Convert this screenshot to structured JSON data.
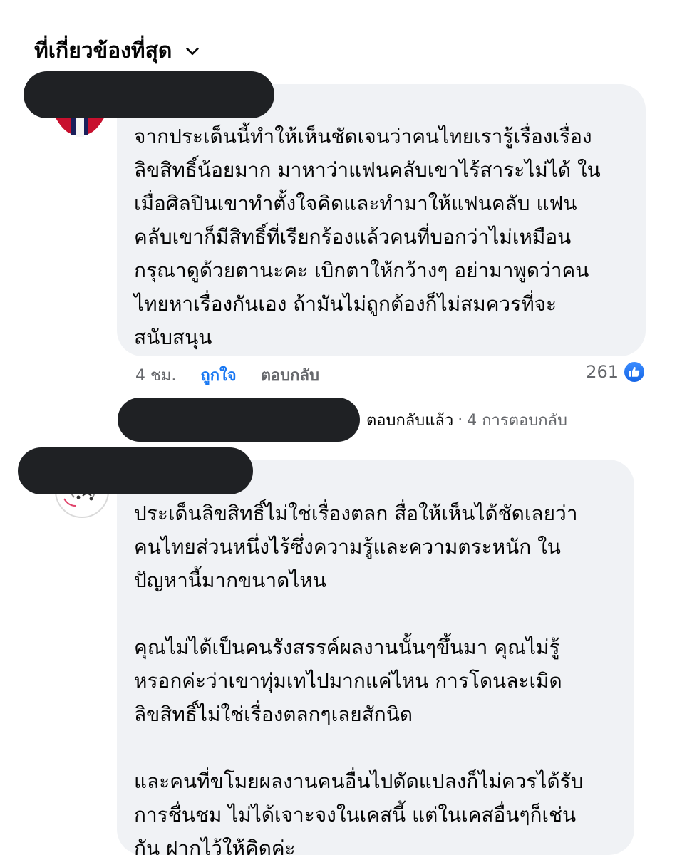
{
  "sort": {
    "label": "ที่เกี่ยวข้องที่สุด",
    "icon": "chevron-down-icon"
  },
  "comments": [
    {
      "author": "",
      "lines": [
        "จากประเด็นนี้ทำให้เห็นชัดเจนว่าคนไทยเรารู้เรื่องเรื่อง",
        "ลิขสิทธิ์น้อยมาก มาหาว่าแฟนคลับเขาไร้สาระไม่ได้ ใน",
        "เมื่อศิลปินเขาทำตั้งใจคิดและทำมาให้แฟนคลับ แฟน",
        "คลับเขาก็มีสิทธิ์ที่เรียกร้องแล้วคนที่บอกว่าไม่เหมือน",
        "กรุณาดูด้วยตานะคะ เบิกตาให้กว้างๆ อย่ามาพูดว่าคน",
        "ไทยหาเรื่องกันเอง ถ้ามันไม่ถูกต้องก็ไม่สมควรที่จะ",
        "สนับสนุน"
      ],
      "time": "4 ชม.",
      "like_label": "ถูกใจ",
      "reply_label": "ตอบกลับ",
      "reaction_count": "261",
      "reaction_icon": "thumbs-up-icon",
      "reaction_color": "#1877f2",
      "replies": {
        "replied_label": "ตอบกลับแล้ว",
        "separator": "·",
        "count_label": "4 การตอบกลับ"
      }
    },
    {
      "author": "",
      "paragraphs": [
        [
          "ประเด็นลิขสิทธิ์ไม่ใช่เรื่องตลก สื่อให้เห็นได้ชัดเลยว่า",
          "คนไทยส่วนหนึ่งไร้ซึ่งความรู้และความตระหนัก ใน",
          "ปัญหานี้มากขนาดไหน"
        ],
        [
          "คุณไม่ได้เป็นคนรังสรรค์ผลงานนั้นๆขึ้นมา คุณไม่รู้",
          "หรอกค่ะว่าเขาทุ่มเทไปมากแค่ไหน การโดนละเมิด",
          "ลิขสิทธิ์ไม่ใช่เรื่องตลกๆเลยสักนิด"
        ],
        [
          "และคนที่ขโมยผลงานคนอื่นไปดัดแปลงก็ไม่ควรได้รับ",
          "การชื่นชม ไม่ได้เจาะจงในเคสนี้ แต่ในเคสอื่นๆก็เช่น",
          "กัน ฝากไว้ให้คิดค่ะ"
        ]
      ]
    }
  ],
  "colors": {
    "bubble_bg": "#f0f2f5",
    "link_blue": "#1877f2",
    "meta_gray": "#65676b",
    "redaction": "#1f2124"
  }
}
